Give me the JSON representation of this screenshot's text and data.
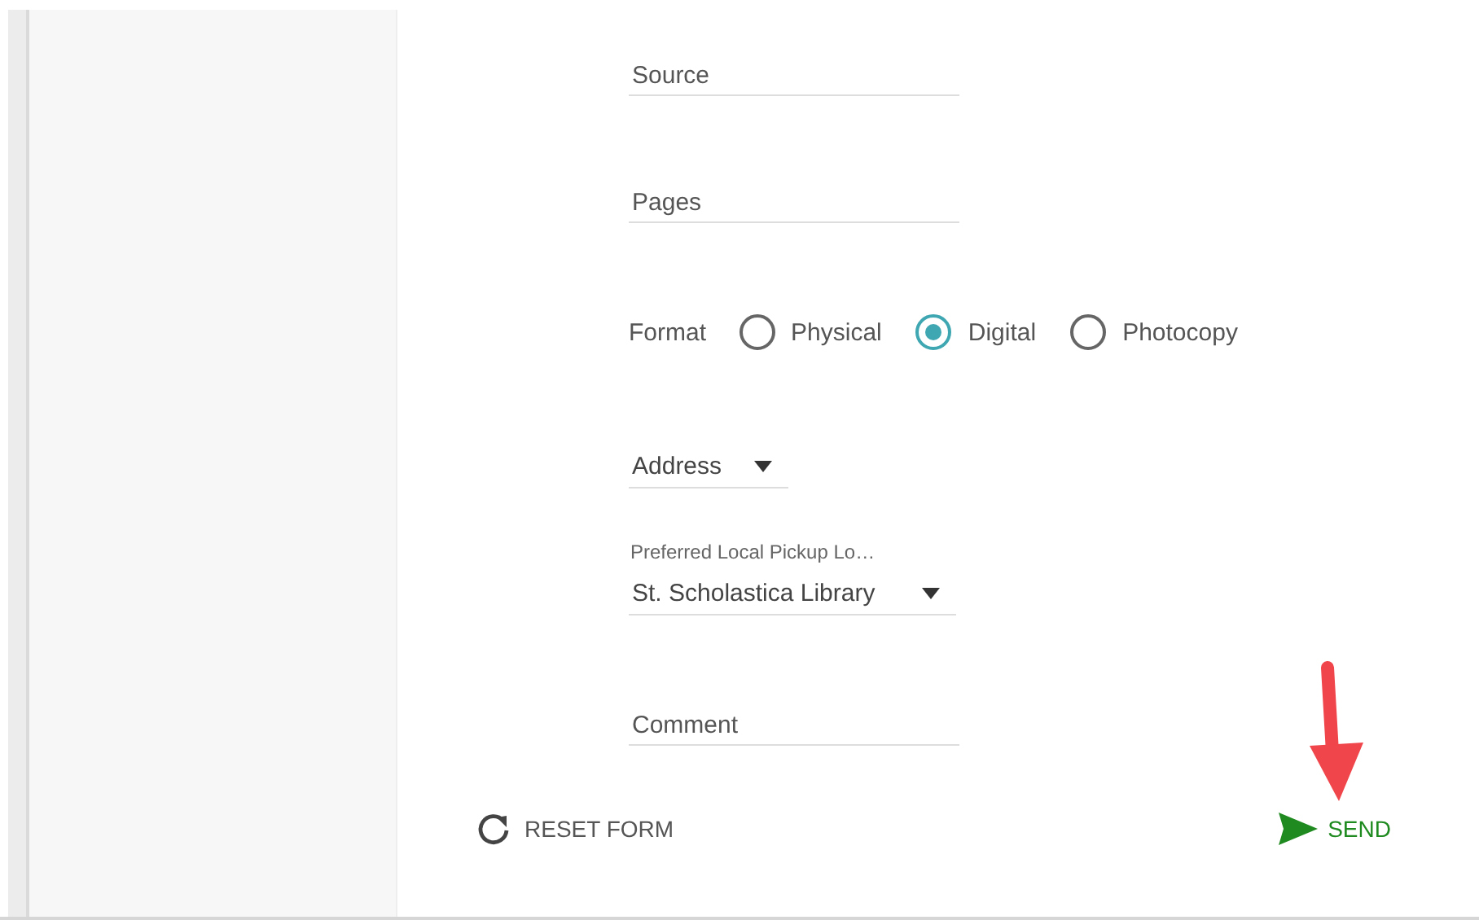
{
  "form": {
    "source": {
      "placeholder": "Source"
    },
    "pages": {
      "placeholder": "Pages"
    },
    "format": {
      "label": "Format",
      "options": [
        {
          "label": "Physical",
          "selected": false
        },
        {
          "label": "Digital",
          "selected": true
        },
        {
          "label": "Photocopy",
          "selected": false
        }
      ]
    },
    "address": {
      "value": "Address"
    },
    "pickup": {
      "label": "Preferred Local Pickup Lo…",
      "value": "St. Scholastica Library"
    },
    "comment": {
      "placeholder": "Comment"
    }
  },
  "actions": {
    "reset": "RESET FORM",
    "send": "SEND"
  }
}
